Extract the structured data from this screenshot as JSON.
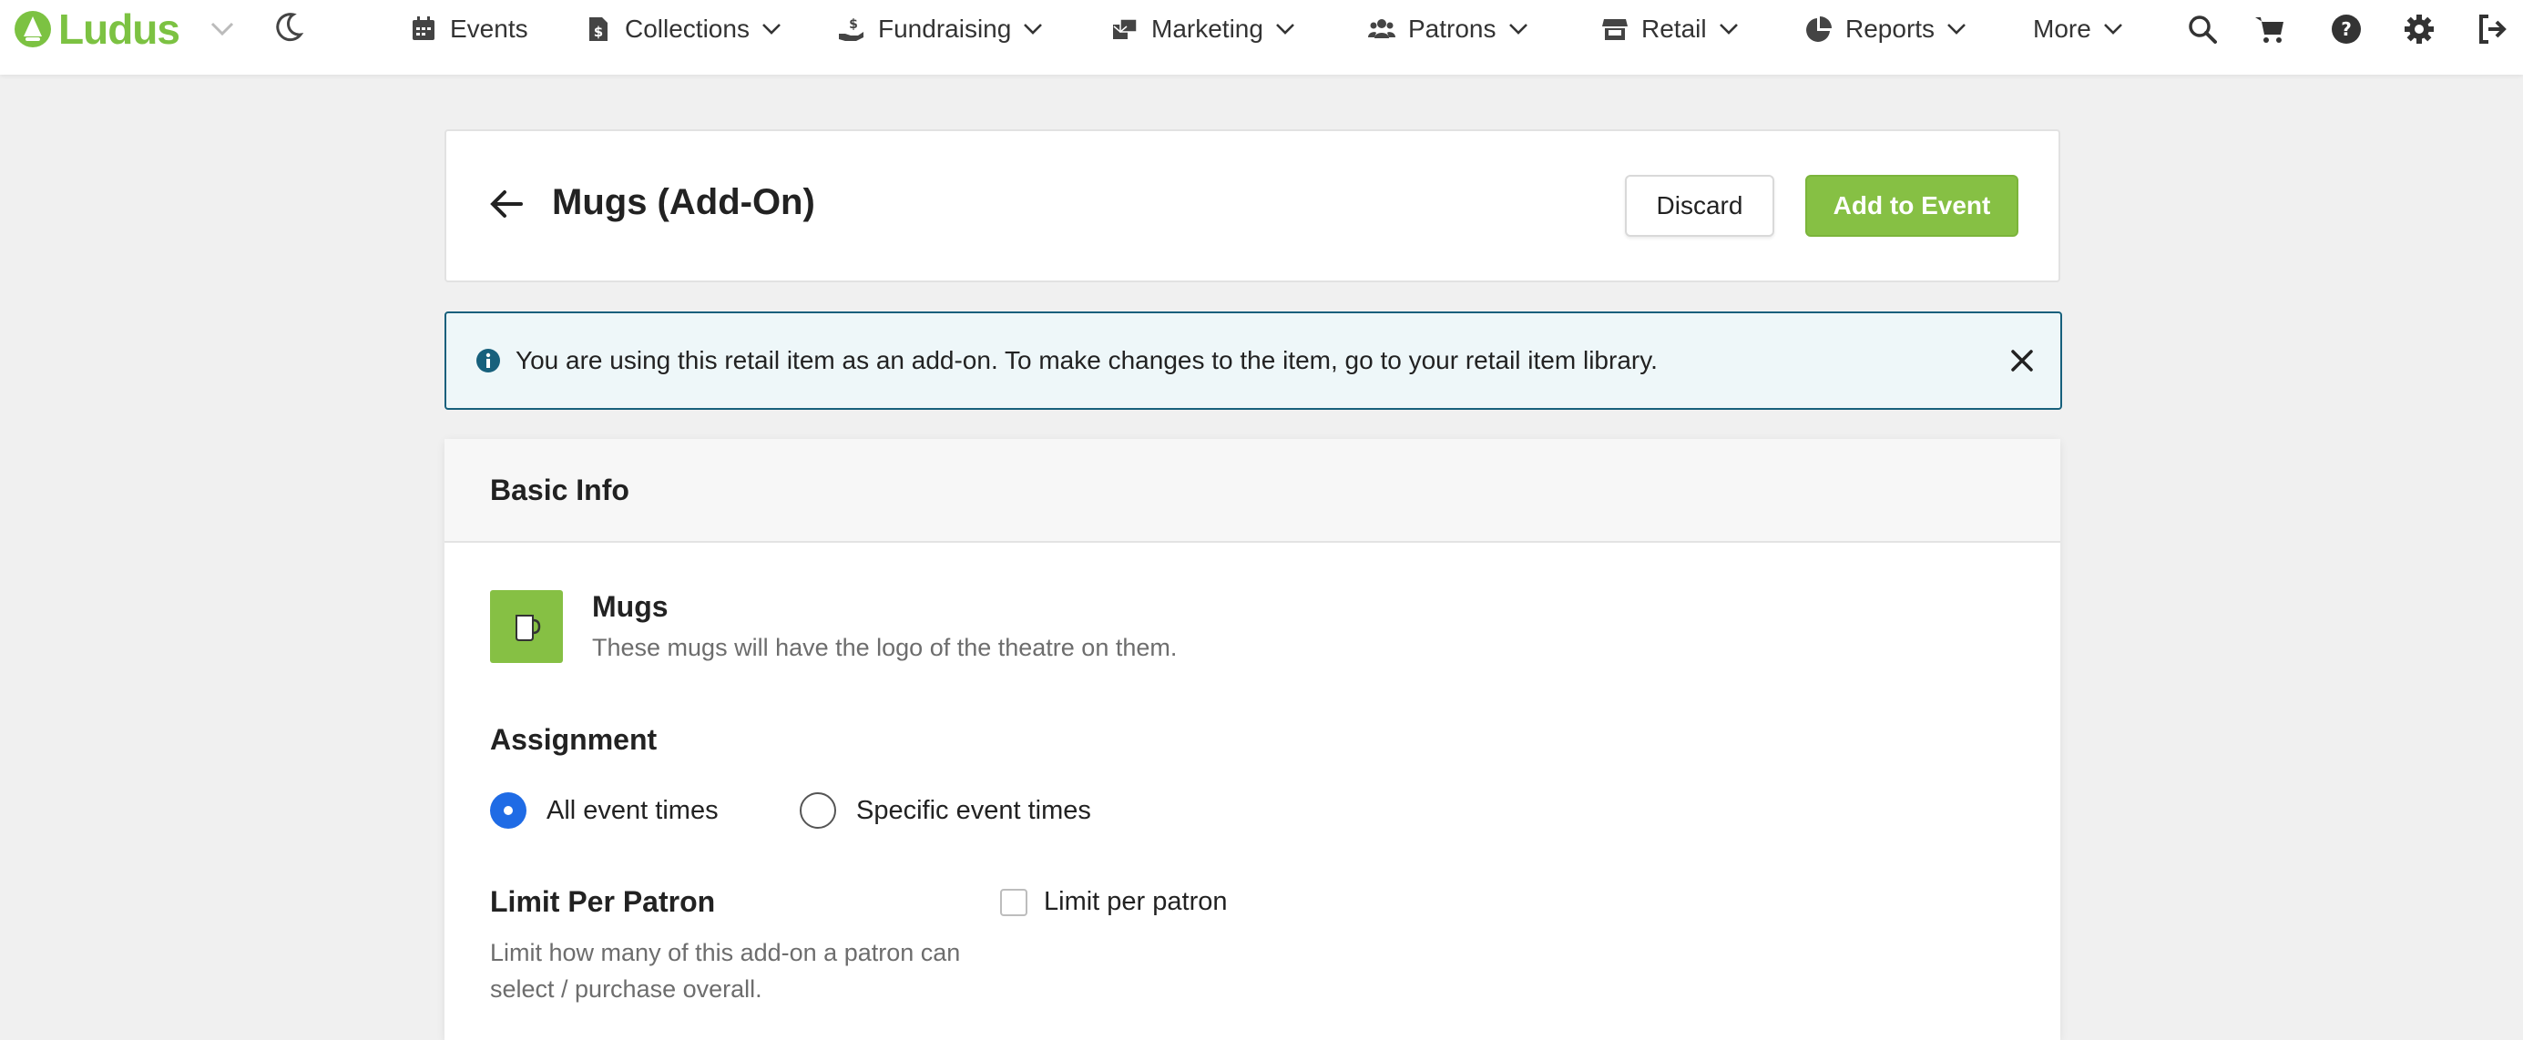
{
  "brand": {
    "name": "Ludus",
    "color": "#7cc242"
  },
  "nav": {
    "items": [
      {
        "label": "Events",
        "icon": "calendar-icon"
      },
      {
        "label": "Collections",
        "icon": "dollar-file-icon"
      },
      {
        "label": "Fundraising",
        "icon": "hand-dollar-icon"
      },
      {
        "label": "Marketing",
        "icon": "mail-bulk-icon"
      },
      {
        "label": "Patrons",
        "icon": "users-icon"
      },
      {
        "label": "Retail",
        "icon": "store-icon"
      },
      {
        "label": "Reports",
        "icon": "pie-chart-icon"
      },
      {
        "label": "More"
      }
    ],
    "right_icons": [
      "search-icon",
      "cart-icon",
      "help-icon",
      "gear-icon",
      "logout-icon"
    ]
  },
  "header": {
    "title": "Mugs (Add-On)",
    "discard_label": "Discard",
    "add_label": "Add to Event"
  },
  "banner": {
    "text": "You are using this retail item as an add-on. To make changes to the item, go to your retail item library."
  },
  "basic_info": {
    "section_title": "Basic Info",
    "item": {
      "name": "Mugs",
      "description": "These mugs will have the logo of the theatre on them."
    },
    "assignment": {
      "label": "Assignment",
      "options": [
        {
          "label": "All event times",
          "selected": true
        },
        {
          "label": "Specific event times",
          "selected": false
        }
      ]
    },
    "limit": {
      "label": "Limit Per Patron",
      "help": "Limit how many of this add-on a patron can select / purchase overall.",
      "checkbox_label": "Limit per patron",
      "checked": false
    }
  },
  "colors": {
    "accent_green": "#86c044",
    "radio_blue": "#1f6be5",
    "banner_border": "#17607c",
    "banner_bg": "#eef7f9"
  }
}
